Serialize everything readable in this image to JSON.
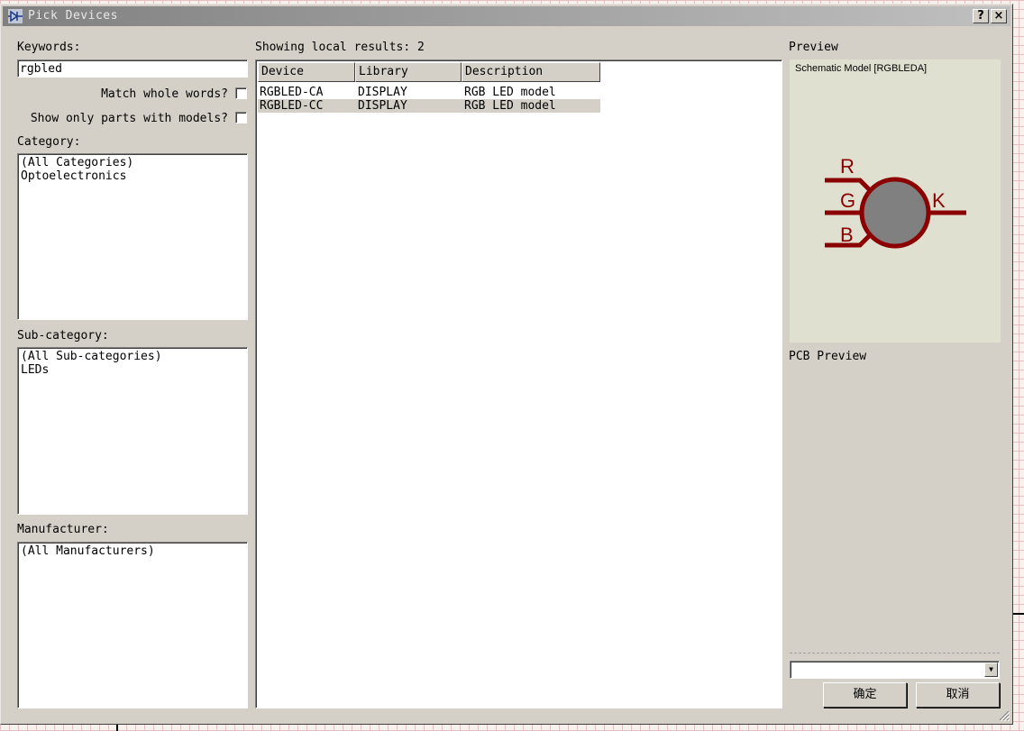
{
  "window": {
    "title": "Pick Devices",
    "help_label": "?",
    "close_label": "×"
  },
  "keywords": {
    "label": "Keywords:",
    "value": "rgbled",
    "match_whole_words_label": "Match whole words?",
    "match_whole_words_checked": false,
    "only_models_label": "Show only parts with models?",
    "only_models_checked": false
  },
  "category": {
    "label": "Category:",
    "items": [
      "(All Categories)",
      "Optoelectronics"
    ]
  },
  "subcategory": {
    "label": "Sub-category:",
    "items": [
      "(All Sub-categories)",
      "LEDs"
    ]
  },
  "manufacturer": {
    "label": "Manufacturer:",
    "items": [
      "(All Manufacturers)"
    ]
  },
  "results": {
    "summary": "Showing local results: 2",
    "columns": [
      "Device",
      "Library",
      "Description"
    ],
    "rows": [
      {
        "device": "RGBLED-CA",
        "library": "DISPLAY",
        "description": "RGB LED model",
        "selected": false
      },
      {
        "device": "RGBLED-CC",
        "library": "DISPLAY",
        "description": "RGB LED model",
        "selected": true
      }
    ]
  },
  "preview": {
    "label": "Preview",
    "caption": "Schematic Model [RGBLEDA]",
    "pins": {
      "r": "R",
      "g": "G",
      "b": "B",
      "k": "K"
    },
    "symbol_color": "#8b0000",
    "body_color": "#808080"
  },
  "pcb_preview": {
    "label": "PCB Preview",
    "package_value": ""
  },
  "buttons": {
    "ok": "确定",
    "cancel": "取消"
  }
}
